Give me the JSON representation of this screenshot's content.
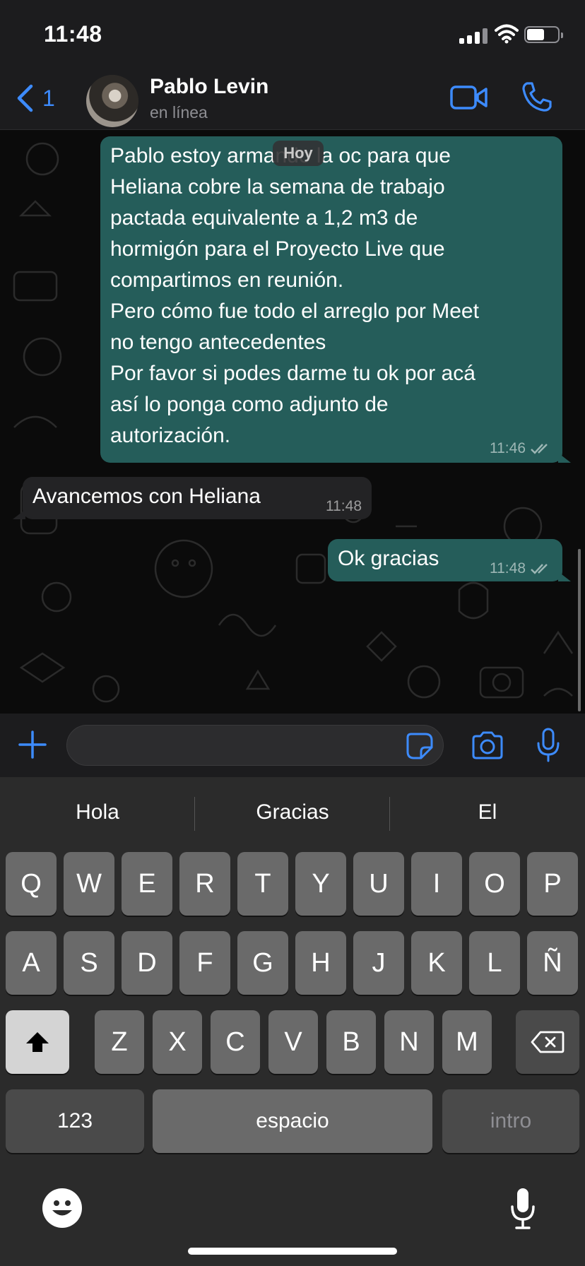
{
  "status_bar": {
    "time": "11:48"
  },
  "header": {
    "back_count": "1",
    "contact_name": "Pablo Levin",
    "contact_status": "en línea"
  },
  "chat": {
    "date_pill": "Hoy",
    "messages": [
      {
        "direction": "outgoing",
        "text": "Pablo estoy armando la oc para que\nHeliana cobre la semana de trabajo\npactada equivalente a 1,2 m3 de\nhormigón para el Proyecto Live que\ncompartimos en reunión.\nPero cómo fue todo el arreglo por Meet\nno tengo antecedentes\nPor favor si podes darme tu ok por acá\nasí lo ponga como adjunto de\nautorización.",
        "time": "11:46",
        "ticks": "read"
      },
      {
        "direction": "incoming",
        "text": "Avancemos con Heliana",
        "time": "11:48"
      },
      {
        "direction": "outgoing",
        "text": "Ok gracias",
        "time": "11:48",
        "ticks": "read"
      }
    ]
  },
  "input": {
    "placeholder": "",
    "value": ""
  },
  "keyboard": {
    "suggestions": [
      "Hola",
      "Gracias",
      "El"
    ],
    "row1": [
      "Q",
      "W",
      "E",
      "R",
      "T",
      "Y",
      "U",
      "I",
      "O",
      "P"
    ],
    "row2": [
      "A",
      "S",
      "D",
      "F",
      "G",
      "H",
      "J",
      "K",
      "L",
      "Ñ"
    ],
    "row3": [
      "Z",
      "X",
      "C",
      "V",
      "B",
      "N",
      "M"
    ],
    "numbers_key": "123",
    "space_key": "espacio",
    "return_key": "intro"
  },
  "colors": {
    "accent": "#3d8bfd",
    "outgoing_bubble": "#255d5a",
    "incoming_bubble": "#232325"
  },
  "icons": [
    "chevron-left-icon",
    "video-icon",
    "phone-icon",
    "plus-icon",
    "sticker-icon",
    "camera-icon",
    "microphone-icon",
    "shift-icon",
    "backspace-icon",
    "emoji-icon",
    "dictation-icon"
  ]
}
